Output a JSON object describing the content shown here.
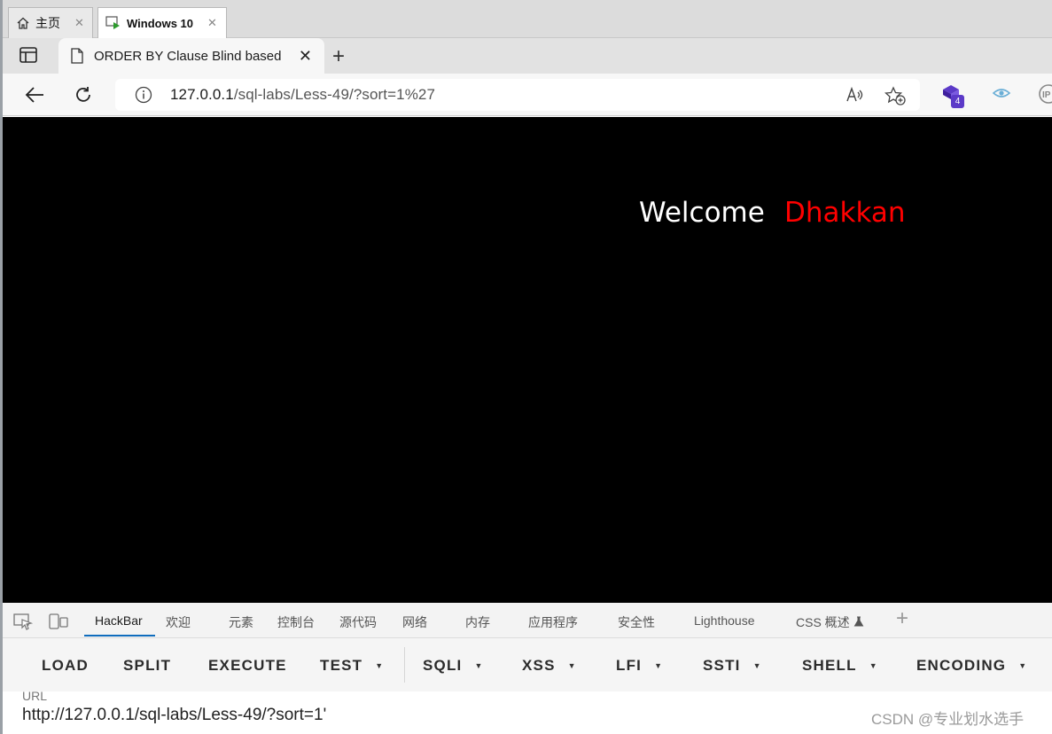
{
  "vm_tabs": [
    {
      "label": "主页",
      "active": false
    },
    {
      "label": "Windows 10",
      "active": true
    }
  ],
  "browser": {
    "tab_title": "ORDER BY Clause Blind based",
    "url_host": "127.0.0.1",
    "url_path": "/sql-labs/Less-49/?sort=1%27",
    "extension_badge": "4"
  },
  "page": {
    "welcome": "Welcome",
    "name": "Dhakkan",
    "background_color": "#000000",
    "name_color": "#ff0000"
  },
  "devtools": {
    "tabs": [
      "HackBar",
      "欢迎",
      "元素",
      "控制台",
      "源代码",
      "网络",
      "内存",
      "应用程序",
      "安全性",
      "Lighthouse",
      "CSS 概述"
    ],
    "active_tab": "HackBar"
  },
  "hackbar": {
    "buttons": [
      {
        "label": "LOAD",
        "dropdown": false
      },
      {
        "label": "SPLIT",
        "dropdown": false
      },
      {
        "label": "EXECUTE",
        "dropdown": false
      },
      {
        "label": "TEST",
        "dropdown": true
      },
      {
        "label": "SQLI",
        "dropdown": true
      },
      {
        "label": "XSS",
        "dropdown": true
      },
      {
        "label": "LFI",
        "dropdown": true
      },
      {
        "label": "SSTI",
        "dropdown": true
      },
      {
        "label": "SHELL",
        "dropdown": true
      },
      {
        "label": "ENCODING",
        "dropdown": true
      }
    ],
    "url_label": "URL",
    "url_value": "http://127.0.0.1/sql-labs/Less-49/?sort=1'"
  },
  "watermark": "CSDN @专业划水选手"
}
